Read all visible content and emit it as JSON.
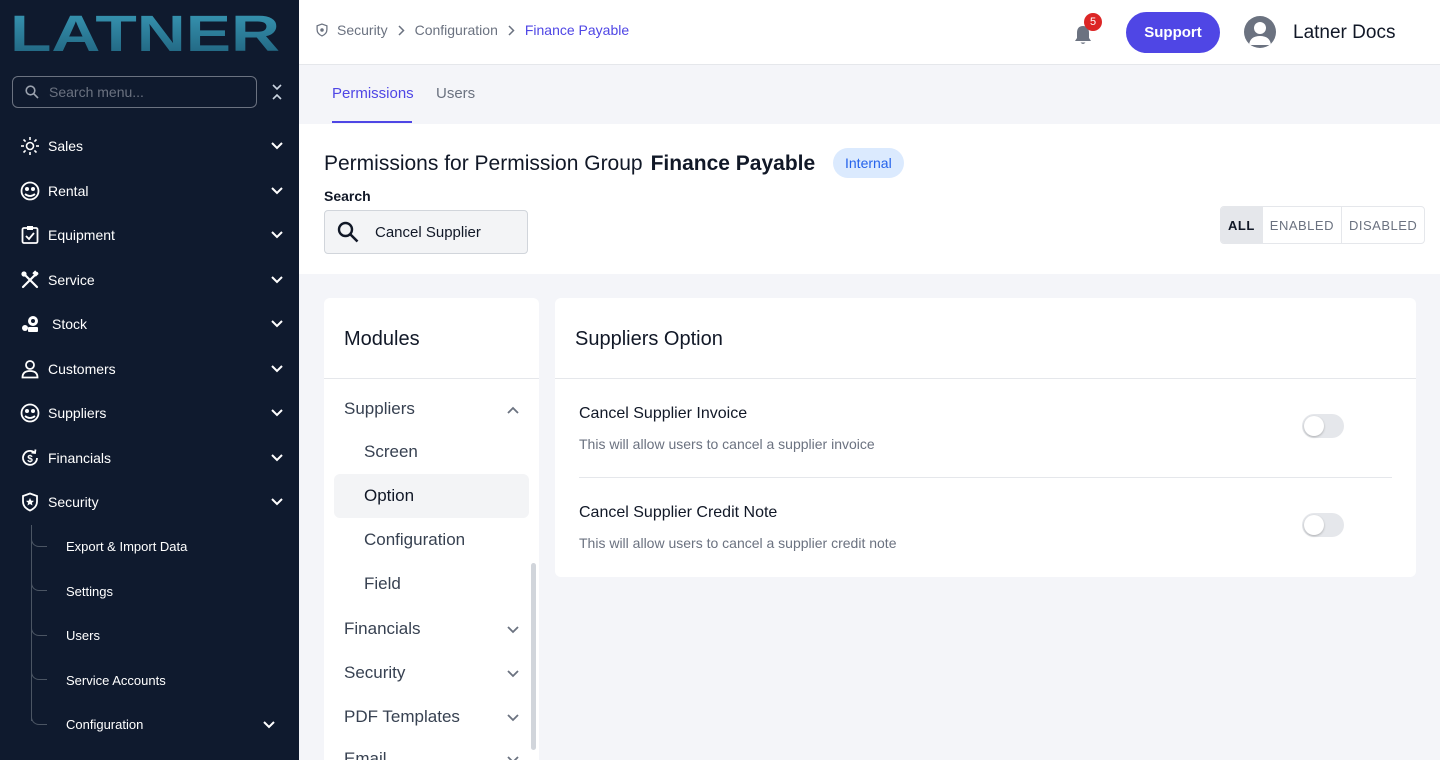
{
  "app": {
    "logo_text": "LATNER"
  },
  "sidebar": {
    "search_placeholder": "Search menu...",
    "items": [
      {
        "label": "Sales",
        "icon": "sales-icon"
      },
      {
        "label": "Rental",
        "icon": "rental-icon"
      },
      {
        "label": "Equipment",
        "icon": "equipment-icon"
      },
      {
        "label": "Service",
        "icon": "service-icon"
      },
      {
        "label": "Stock",
        "icon": "stock-icon"
      },
      {
        "label": "Customers",
        "icon": "customers-icon"
      },
      {
        "label": "Suppliers",
        "icon": "suppliers-icon"
      },
      {
        "label": "Financials",
        "icon": "financials-icon"
      },
      {
        "label": "Security",
        "icon": "security-icon"
      }
    ],
    "security_children": [
      {
        "label": "Export & Import Data"
      },
      {
        "label": "Settings"
      },
      {
        "label": "Users"
      },
      {
        "label": "Service Accounts"
      },
      {
        "label": "Configuration"
      }
    ]
  },
  "topbar": {
    "breadcrumb": [
      "Security",
      "Configuration",
      "Finance Payable"
    ],
    "notification_count": "5",
    "support_label": "Support",
    "user_name": "Latner Docs"
  },
  "tabs": [
    {
      "label": "Permissions",
      "active": true
    },
    {
      "label": "Users",
      "active": false
    }
  ],
  "header": {
    "title_prefix": "Permissions for Permission Group",
    "group_name": "Finance Payable",
    "badge": "Internal",
    "search_label": "Search",
    "search_value": "Cancel Supplier",
    "filters": [
      "ALL",
      "ENABLED",
      "DISABLED"
    ],
    "active_filter": "ALL"
  },
  "modules": {
    "title": "Modules",
    "expanded": {
      "label": "Suppliers",
      "children": [
        "Screen",
        "Option",
        "Configuration",
        "Field"
      ],
      "active_child": "Option"
    },
    "collapsed": [
      "Financials",
      "Security",
      "PDF Templates",
      "Email"
    ]
  },
  "options": {
    "title": "Suppliers Option",
    "rows": [
      {
        "title": "Cancel Supplier Invoice",
        "description": "This will allow users to cancel a supplier invoice",
        "enabled": false
      },
      {
        "title": "Cancel Supplier Credit Note",
        "description": "This will allow users to cancel a supplier credit note",
        "enabled": false
      }
    ]
  },
  "colors": {
    "sidebar_bg": "#0f1a2e",
    "accent": "#4f46e5",
    "badge_red": "#dc2626",
    "internal_badge_bg": "#dbeafe",
    "internal_badge_text": "#2563eb",
    "logo_gradient": [
      "#1e5f7a",
      "#3a9bb8"
    ]
  }
}
